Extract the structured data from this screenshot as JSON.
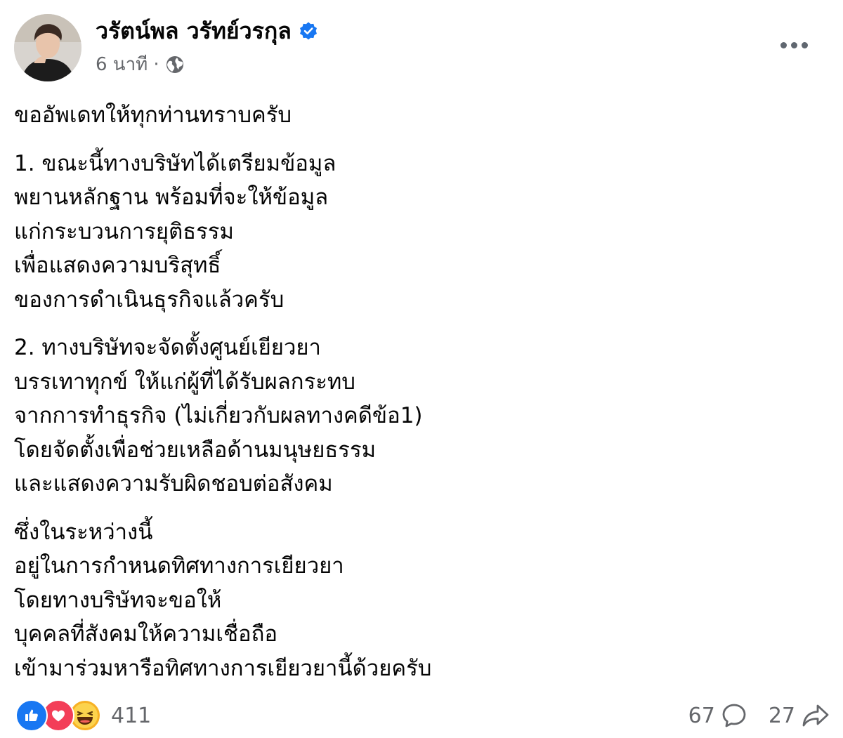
{
  "post": {
    "author": "วรัตน์พล วรัทย์วรกุล",
    "time": "6 นาที",
    "separator": "·",
    "paragraphs": [
      [
        "ขออัพเดทให้ทุกท่านทราบครับ"
      ],
      [
        "1. ขณะนี้ทางบริษัทได้เตรียมข้อมูล",
        "พยานหลักฐาน พร้อมที่จะให้ข้อมูล",
        "แก่กระบวนการยุติธรรม",
        "เพื่อแสดงความบริสุทธิ์",
        "ของการดำเนินธุรกิจแล้วครับ"
      ],
      [
        "2. ทางบริษัทจะจัดตั้งศูนย์เยียวยา",
        "บรรเทาทุกข์ ให้แก่ผู้ที่ได้รับผลกระทบ",
        "จากการทำธุรกิจ (ไม่เกี่ยวกับผลทางคดีข้อ1)",
        "โดยจัดตั้งเพื่อช่วยเหลือด้านมนุษยธรรม",
        "และแสดงความรับผิดชอบต่อสังคม"
      ],
      [
        "ซึ่งในระหว่างนี้",
        "อยู่ในการกำหนดทิศทางการเยียวยา",
        "โดยทางบริษัทจะขอให้",
        "บุคคลที่สังคมให้ความเชื่อถือ",
        "เข้ามาร่วมหารือทิศทางการเยียวยานี้ด้วยครับ"
      ]
    ]
  },
  "footer": {
    "reaction_count": "411",
    "comment_count": "67",
    "share_count": "27"
  },
  "icons": {
    "verified": "verified-badge-icon",
    "audience": "globe-icon",
    "more": "more-options-icon",
    "reactions": [
      "like-icon",
      "love-icon",
      "haha-icon"
    ],
    "comment": "comment-icon",
    "share": "share-icon"
  },
  "colors": {
    "verified_blue": "#1877f2",
    "secondary_text": "#65676b",
    "like": "#1877f2",
    "love": "#f33e58",
    "haha": "#f7b125"
  }
}
